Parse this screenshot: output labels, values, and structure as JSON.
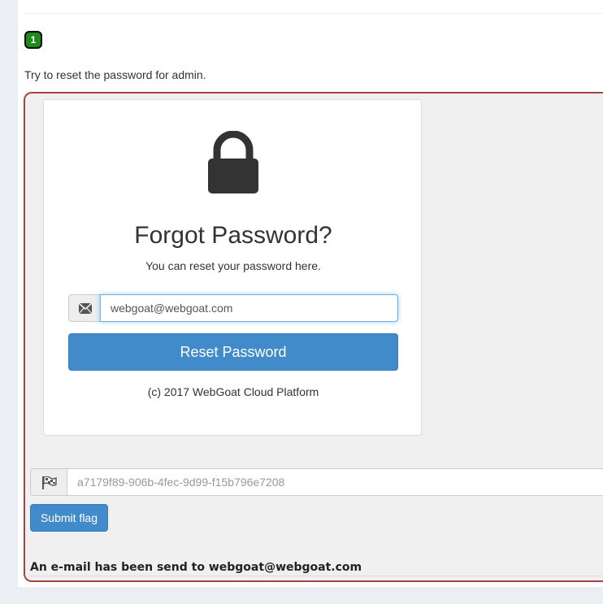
{
  "lesson": {
    "number": "1",
    "badge_color": "#1e8a1a"
  },
  "instruction": "Try to reset the password for admin.",
  "card": {
    "icon": "lock-icon",
    "title": "Forgot Password?",
    "subtitle": "You can reset your password here.",
    "email_icon": "envelope-icon",
    "email_value": "webgoat@webgoat.com",
    "reset_button": "Reset Password",
    "footer": "(c) 2017 WebGoat Cloud Platform"
  },
  "flag": {
    "icon": "flag-icon",
    "placeholder": "a7179f89-906b-4fec-9d99-f15b796e7208",
    "submit_label": "Submit flag"
  },
  "feedback": "An e-mail has been send to webgoat@webgoat.com",
  "colors": {
    "primary": "#428bca",
    "attack_border": "#a94442"
  }
}
